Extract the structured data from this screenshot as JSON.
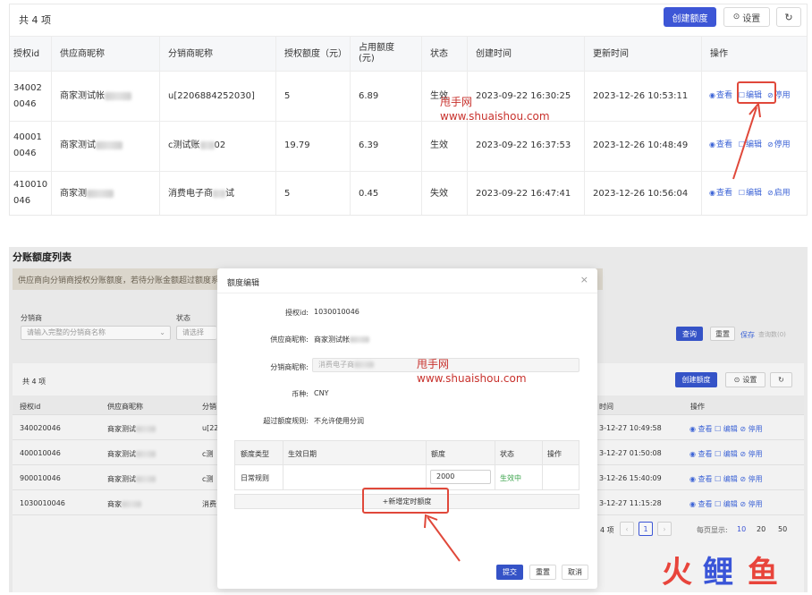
{
  "top": {
    "count": "共 4 项",
    "create_label": "创建额度",
    "settings_label": "设置",
    "settings_icon": "gear-icon",
    "refresh_icon": "refresh-icon",
    "columns": [
      "授权id",
      "供应商昵称",
      "分销商昵称",
      "授权额度（元）",
      "占用额度\n(元)",
      "状态",
      "创建时间",
      "更新时间",
      "操作"
    ],
    "rows": [
      {
        "id": "34002\n0046",
        "supplier": "商家测试帐",
        "distributor": "u[2206884252030]",
        "quota": "5",
        "used": "6.89",
        "status": "生效",
        "created": "2023-09-22 16:30:25",
        "updated": "2023-12-26 10:53:11",
        "view": "查看",
        "edit": "编辑",
        "toggle": "停用"
      },
      {
        "id": "40001\n0046",
        "supplier": "商家测试",
        "distributor": "c测试账",
        "distributor_suffix": "02",
        "quota": "19.79",
        "used": "6.39",
        "status": "生效",
        "created": "2023-09-22 16:37:53",
        "updated": "2023-12-26 10:48:49",
        "view": "查看",
        "edit": "编辑",
        "toggle": "停用"
      },
      {
        "id": "410010\n046",
        "supplier": "商家测",
        "distributor": "消费电子商",
        "distributor_suffix": "试",
        "quota": "5",
        "used": "0.45",
        "status": "失效",
        "created": "2023-09-22 16:47:41",
        "updated": "2023-12-26 10:56:04",
        "view": "查看",
        "edit": "编辑",
        "toggle": "启用"
      }
    ]
  },
  "watermark": {
    "line1": "甩手网",
    "line2": "www.shuaishou.com"
  },
  "bottom": {
    "title": "分账额度列表",
    "notice": "供应商向分销商授权分账额度，若待分账金额超过额度系",
    "filters": {
      "distributor_label": "分销商",
      "distributor_placeholder": "请输入完整的分销商名称",
      "status_label": "状态",
      "status_placeholder": "请选择"
    },
    "query_label": "查询",
    "reset_label": "重置",
    "save_label": "保存",
    "unfold_label": "查询数(0)",
    "count": "共 4 项",
    "create_label": "创建额度",
    "settings_label": "设置",
    "columns": [
      "授权id",
      "供应商昵称",
      "分销",
      "时间",
      "操作"
    ],
    "rows": [
      {
        "id": "340020046",
        "supplier": "商家测试",
        "dist": "u[22",
        "time": "3-12-27 10:49:58"
      },
      {
        "id": "400010046",
        "supplier": "商家测试",
        "dist": "c测",
        "time": "3-12-27 01:50:08"
      },
      {
        "id": "900010046",
        "supplier": "商家测试",
        "dist": "c测",
        "time": "3-12-26 15:40:09"
      },
      {
        "id": "1030010046",
        "supplier": "商家",
        "dist": "消费",
        "time": "3-12-27 11:15:28"
      }
    ],
    "row_actions": {
      "view": "查看",
      "edit": "编辑",
      "toggle": "停用"
    },
    "pagination": {
      "total": "4 项",
      "page": "1",
      "page_size_label": "每页显示:",
      "sizes": [
        "10",
        "20",
        "50"
      ]
    }
  },
  "modal": {
    "title": "额度编辑",
    "fields": [
      {
        "label": "授权id:",
        "value": "1030010046"
      },
      {
        "label": "供应商昵称:",
        "value": "商家测试帐"
      },
      {
        "label": "分销商昵称:",
        "value": "消费电子商"
      },
      {
        "label": "币种:",
        "value": "CNY"
      },
      {
        "label": "超过额度规则:",
        "value": "不允许使用分润"
      }
    ],
    "table_columns": [
      "额度类型",
      "生效日期",
      "额度",
      "状态",
      "操作"
    ],
    "table_row": {
      "type": "日常规则",
      "amount": "2000",
      "status": "生效中"
    },
    "add_label": "+新增定时额度",
    "submit_label": "提交",
    "reset_label": "重置",
    "cancel_label": "取消"
  },
  "logo": {
    "chars": [
      "火",
      "鲤",
      "鱼"
    ]
  },
  "colors": {
    "primary": "#3d56d6",
    "link": "#3d64d6",
    "highlight": "#e0483a",
    "success": "#3aa34b",
    "logo_red": "#e8443b",
    "logo_blue": "#3a55d8"
  }
}
